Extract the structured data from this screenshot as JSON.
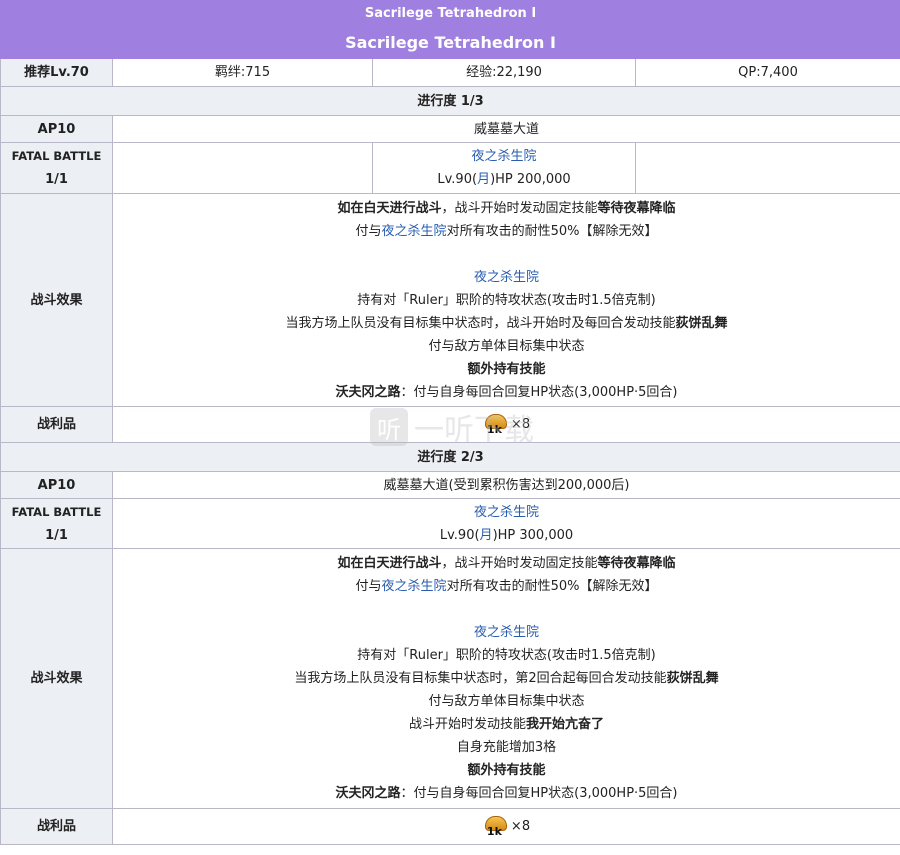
{
  "header": {
    "title_small": "Sacrilege Tetrahedron Ⅰ",
    "title_large": "Sacrilege Tetrahedron Ⅰ"
  },
  "summary": {
    "level": "推荐Lv.70",
    "bond": "羁绊:715",
    "exp": "经验:22,190",
    "qp": "QP:7,400"
  },
  "stages": [
    {
      "progress": "进行度 1/3",
      "ap": "AP10",
      "field": "威墓墓大道",
      "fatal_label": "FATAL BATTLE",
      "fatal_count": "1/1",
      "enemy_name": "夜之杀生院",
      "enemy_lv_pre": "Lv.90(",
      "enemy_class": "月",
      "enemy_lv_post": ")HP 200,000",
      "effect_label": "战斗效果",
      "effects": {
        "l1_a": "如在白天进行战斗",
        "l1_b": "，战斗开始时发动固定技能",
        "l1_c": "等待夜幕降临",
        "l2_a": "付与",
        "l2_b": "夜之杀生院",
        "l2_c": "对所有攻击的耐性50%【解除无效】",
        "l3": "夜之杀生院",
        "l4": "持有对「Ruler」职阶的特攻状态(攻击时1.5倍克制)",
        "l5_a": "当我方场上队员没有目标集中状态时，战斗开始时及每回合发动技能",
        "l5_b": "荻饼乱舞",
        "l6": "付与敌方单体目标集中状态",
        "l7": "额外持有技能",
        "l8_a": "沃夫冈之路",
        "l8_b": "：付与自身每回合回复HP状态(3,000HP·5回合)"
      },
      "loot_label": "战利品",
      "loot_qty": "1k",
      "loot_mult": "×8"
    },
    {
      "progress": "进行度 2/3",
      "ap": "AP10",
      "field": "威墓墓大道(受到累积伤害达到200,000后)",
      "fatal_label": "FATAL BATTLE",
      "fatal_count": "1/1",
      "enemy_name": "夜之杀生院",
      "enemy_lv_pre": "Lv.90(",
      "enemy_class": "月",
      "enemy_lv_post": ")HP 300,000",
      "effect_label": "战斗效果",
      "effects": {
        "l1_a": "如在白天进行战斗",
        "l1_b": "，战斗开始时发动固定技能",
        "l1_c": "等待夜幕降临",
        "l2_a": "付与",
        "l2_b": "夜之杀生院",
        "l2_c": "对所有攻击的耐性50%【解除无效】",
        "l3": "夜之杀生院",
        "l4": "持有对「Ruler」职阶的特攻状态(攻击时1.5倍克制)",
        "l5_a": "当我方场上队员没有目标集中状态时，第2回合起每回合发动技能",
        "l5_b": "荻饼乱舞",
        "l6": "付与敌方单体目标集中状态",
        "l7_a": "战斗开始时发动技能",
        "l7_b": "我开始亢奋了",
        "l8": "自身充能增加3格",
        "l9": "额外持有技能",
        "l10_a": "沃夫冈之路",
        "l10_b": "：付与自身每回合回复HP状态(3,000HP·5回合)"
      },
      "loot_label": "战利品",
      "loot_qty": "1k",
      "loot_mult": "×8"
    }
  ],
  "watermark": {
    "icon": "听",
    "text": "一听下载"
  },
  "colors": {
    "header": "#9f7fe0",
    "label_bg": "#eceff3",
    "link": "#2a5db0"
  }
}
